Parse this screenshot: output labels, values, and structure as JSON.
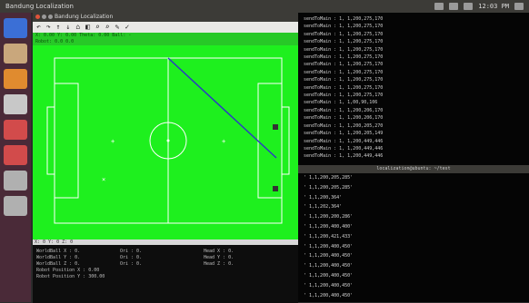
{
  "topbar": {
    "title": "Bandung Localization",
    "clock": "12:03 PM"
  },
  "launcher": {
    "items": [
      {
        "icon": "ubuntu-logo-icon",
        "color": "#3b6fd6"
      },
      {
        "icon": "files-icon",
        "color": "#c9a77c"
      },
      {
        "icon": "firefox-icon",
        "color": "#e08b2f"
      },
      {
        "icon": "settings-icon",
        "color": "#c8c8c8"
      },
      {
        "icon": "media-icon",
        "color": "#d24b4b"
      },
      {
        "icon": "presentation-icon",
        "color": "#d24b4b"
      },
      {
        "icon": "terminal-icon",
        "color": "#b0b0b0"
      },
      {
        "icon": "workspace-icon",
        "color": "#b0b0b0"
      }
    ]
  },
  "app": {
    "title": "Bandung Localization",
    "toolbar": [
      "↶",
      "↷",
      "↑",
      "↓",
      "⌂",
      "◧",
      "⌕",
      "⌕",
      "✎",
      "✓"
    ],
    "status_line_1": "X: 0.00  Y: 0.00  Theta: 0.00  Ball: -",
    "status_line_2": "Robot: 0.0  0.0",
    "coord_bar": "X: 0  Y: 0  Z: 0",
    "info_rows": [
      [
        "WorldBall X : 0.",
        "Ori : 0.",
        "Head X : 0."
      ],
      [
        "WorldBall Y : 0.",
        "Ori : 0.",
        "Head Y : 0."
      ],
      [
        "WorldBall Z : 0.",
        "Ori : 0.",
        "Head Z : 0."
      ],
      [
        "",
        "",
        ""
      ],
      [
        "Robot Position X : 0.00",
        "",
        ""
      ],
      [
        "Robot Position Y : 300.00",
        "",
        ""
      ]
    ]
  },
  "terminal1": {
    "lines": [
      "sendToMain :   1, 1,200,275,170",
      "sendToMain :   1, 1,200,275,170",
      "sendToMain :   1, 1,200,275,170",
      "sendToMain :   1, 1,200,275,170",
      "sendToMain :   1, 1,200,275,170",
      "sendToMain :   1, 1,200,275,170",
      "sendToMain :   1, 1,200,275,170",
      "sendToMain :   1, 1,200,275,170",
      "sendToMain :   1, 1,200,275,170",
      "sendToMain :   1, 1,200,275,170",
      "sendToMain :   1, 1,200,275,170",
      "sendToMain :   1, 1,00,90,106",
      "sendToMain :   1, 1,200,206,170",
      "sendToMain :   1, 1,200,206,170",
      "sendToMain :   1, 1,200,205,270",
      "sendToMain :   1, 1,200,205,149",
      "sendToMain :   1, 1,200,449,446",
      "sendToMain :   1, 1,200,449,446",
      "sendToMain :   1, 1,200,449,446"
    ]
  },
  "terminal2": {
    "title": "localization@ubuntu: ~/test",
    "lines": [
      "' 1,1,200,205,285'",
      "' 1,1,200,205,285'",
      "' 1,1,200,364'",
      "' 1,1,202,364'",
      "' 1,1,200,200,286'",
      "' 1,1,200,400,400'",
      "' 1,1,200,421,433'",
      "' 1,1,200,400,450'",
      "' 1,1,200,400,450'",
      "' 1,1,200,400,450'",
      "' 1,1,200,400,450'",
      "' 1,1,200,400,450'",
      "' 1,1,200,400,450'"
    ]
  },
  "colors": {
    "field": "#1ef01e",
    "line": "#ffffff",
    "trajectory": "#2b3cc2",
    "landmark": "#333333"
  }
}
